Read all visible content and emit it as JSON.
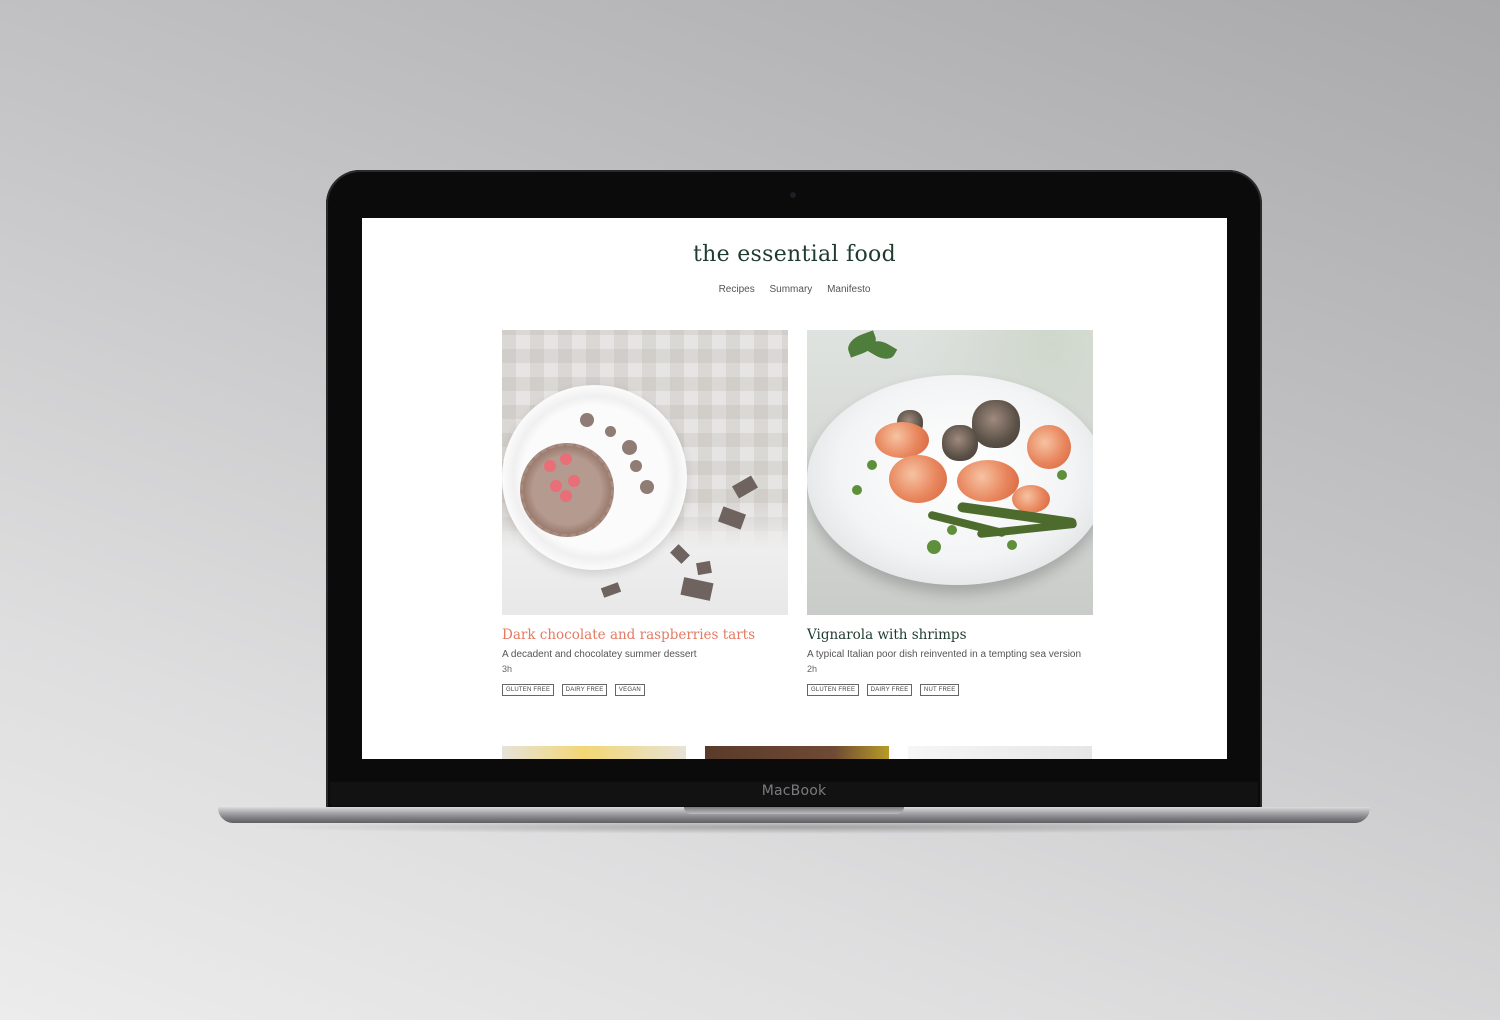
{
  "site": {
    "title": "the essential food",
    "nav": [
      "Recipes",
      "Summary",
      "Manifesto"
    ]
  },
  "recipes": [
    {
      "title": "Dark chocolate and raspberries tarts",
      "description": "A decadent and chocolatey summer dessert",
      "time": "3h",
      "tags": [
        "GLUTEN FREE",
        "DAIRY FREE",
        "VEGAN"
      ],
      "title_color": "#e47a63"
    },
    {
      "title": "Vignarola with shrimps",
      "description": "A typical Italian poor dish reinvented in a tempting sea version",
      "time": "2h",
      "tags": [
        "GLUTEN FREE",
        "DAIRY FREE",
        "NUT FREE"
      ],
      "title_color": "#1f3b2e"
    }
  ],
  "device": {
    "brand": "MacBook"
  }
}
